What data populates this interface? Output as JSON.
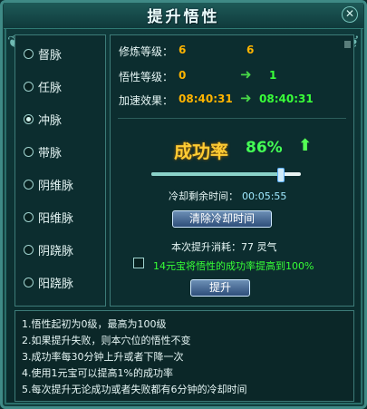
{
  "window": {
    "title": "提升悟性",
    "close_label": "✕"
  },
  "meridians": {
    "items": [
      {
        "label": "督脉",
        "selected": false
      },
      {
        "label": "任脉",
        "selected": false
      },
      {
        "label": "冲脉",
        "selected": true
      },
      {
        "label": "带脉",
        "selected": false
      },
      {
        "label": "阴维脉",
        "selected": false
      },
      {
        "label": "阳维脉",
        "selected": false
      },
      {
        "label": "阴跷脉",
        "selected": false
      },
      {
        "label": "阳跷脉",
        "selected": false
      }
    ]
  },
  "stats": {
    "cultivation_label": "修炼等级：",
    "cultivation_current": "6",
    "cultivation_next": "6",
    "insight_label": "悟性等级：",
    "insight_current": "0",
    "insight_next": "1",
    "speed_label": "加速效果：",
    "speed_current": "08:40:31",
    "speed_next": "08:40:31"
  },
  "success": {
    "title": "成功率",
    "rate": "86%",
    "rate_fraction": 0.86
  },
  "cooldown": {
    "label": "冷却剩余时间：",
    "time": "00:05:55",
    "clear_button": "清除冷却时间"
  },
  "cost": {
    "text": "本次提升消耗：77 灵气"
  },
  "option": {
    "checked": false,
    "label": "14元宝将悟性的成功率提高到100%"
  },
  "upgrade_button": "提升",
  "notes": [
    "1.悟性起初为0级，最高为100级",
    "2.如果提升失败，则本穴位的悟性不变",
    "3.成功率每30分钟上升或者下降一次",
    "4.使用1元宝可以提高1%的成功率",
    "5.每次提升无论成功或者失败都有6分钟的冷却时间"
  ],
  "colors": {
    "value_orange": "#ffb400",
    "value_green": "#39ff39",
    "rate_title": "#ffcc33",
    "frame": "#3f8a86"
  }
}
